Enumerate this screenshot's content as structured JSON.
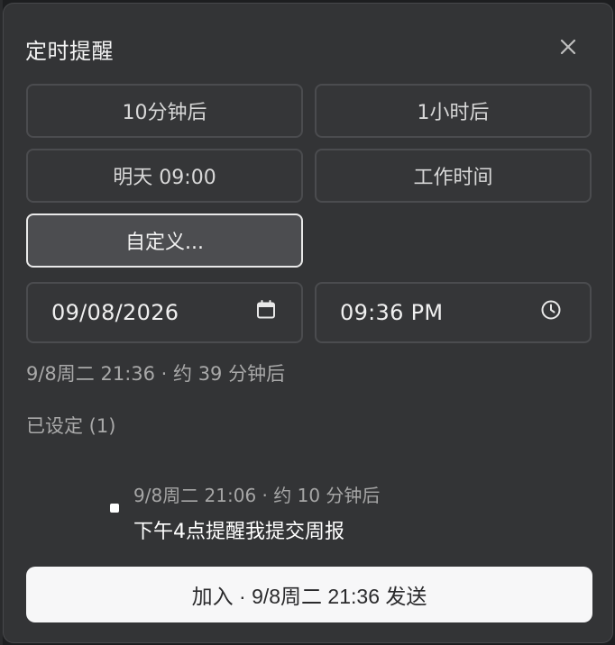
{
  "dialog": {
    "title": "定时提醒",
    "close_icon": "close-icon"
  },
  "presets": {
    "in_10_min": "10分钟后",
    "in_1_hour": "1小时后",
    "tomorrow": "明天 09:00",
    "work_hours": "工作时间",
    "custom": "自定义..."
  },
  "datetime": {
    "date_value": "09/08/2026",
    "date_icon": "calendar-icon",
    "time_value": "09:36 PM",
    "time_icon": "clock-icon"
  },
  "summary": "9/8周二 21:36 · 约 39 分钟后",
  "existing": {
    "heading": "已设定 (1)",
    "items": [
      {
        "time": "9/8周二 21:06 · 约 10 分钟后",
        "text": "下午4点提醒我提交周报"
      }
    ]
  },
  "submit_label": "加入 · 9/8周二 21:36 发送",
  "colors": {
    "background": "#333436",
    "border": "#4b4c4f",
    "active_border": "#e9e9e9",
    "submit_bg": "#f7f7f8"
  }
}
